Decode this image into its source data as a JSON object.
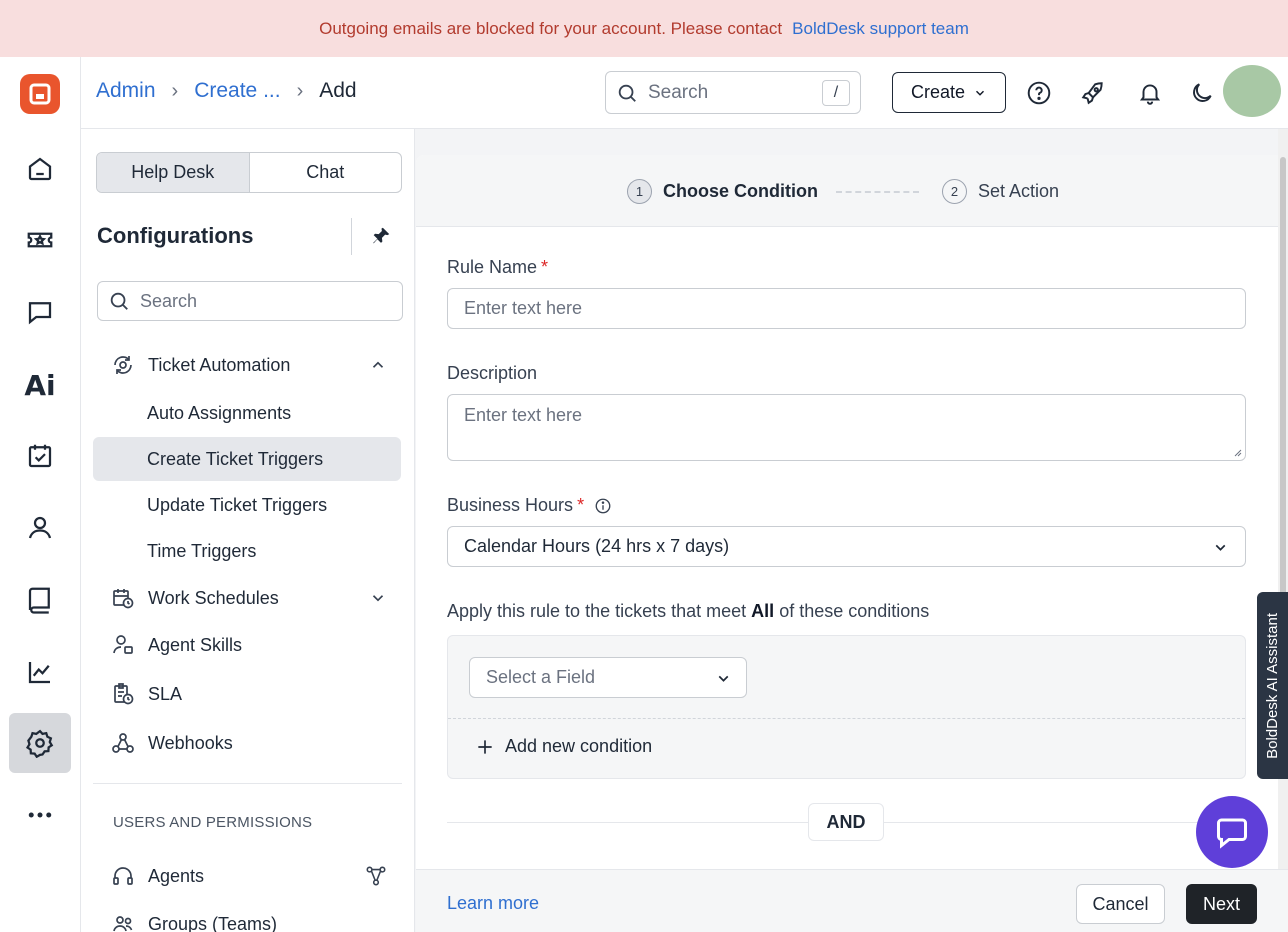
{
  "banner": {
    "message": "Outgoing emails are blocked for your account. Please contact",
    "link": "BoldDesk support team"
  },
  "rail": {
    "items": [
      "home-icon",
      "ticket-icon",
      "chat-icon",
      "ai-icon",
      "tasks-icon",
      "contacts-icon",
      "knowledge-base-icon",
      "reports-icon",
      "settings-icon",
      "more-icon"
    ],
    "ai_label": "Ai"
  },
  "header": {
    "breadcrumb": [
      "Admin",
      "Create ...",
      "Add"
    ],
    "search_placeholder": "Search",
    "search_shortcut": "/",
    "create_label": "Create"
  },
  "sidebar": {
    "tabs": [
      "Help Desk",
      "Chat"
    ],
    "title": "Configurations",
    "search_placeholder": "Search",
    "nav": [
      {
        "label": "Ticket Automation",
        "expanded": true
      },
      {
        "label": "Work Schedules",
        "expanded": false
      },
      {
        "label": "Agent Skills"
      },
      {
        "label": "SLA"
      },
      {
        "label": "Webhooks"
      }
    ],
    "sub_items": [
      "Auto Assignments",
      "Create Ticket Triggers",
      "Update Ticket Triggers",
      "Time Triggers"
    ],
    "selected": "Create Ticket Triggers",
    "section_heading": "USERS AND PERMISSIONS",
    "section_items": [
      "Agents",
      "Groups (Teams)"
    ]
  },
  "steps": [
    {
      "number": "1",
      "label": "Choose Condition"
    },
    {
      "number": "2",
      "label": "Set Action"
    }
  ],
  "form": {
    "rule_name_label": "Rule Name",
    "required_mark": "*",
    "rule_name_placeholder": "Enter text here",
    "description_label": "Description",
    "description_placeholder": "Enter text here",
    "business_hours_label": "Business Hours",
    "business_hours_value": "Calendar Hours (24 hrs x 7 days)",
    "apply_prefix": "Apply this rule to the tickets that meet",
    "apply_keyword": "All",
    "apply_suffix": "of these conditions",
    "field_placeholder": "Select a Field",
    "add_condition": "Add new condition",
    "and_label": "AND"
  },
  "footer": {
    "learn_more": "Learn more",
    "cancel": "Cancel",
    "next": "Next"
  },
  "assistant": {
    "tab_label": "BoldDesk AI Assistant"
  },
  "colors": {
    "accent": "#2f6fd0",
    "banner_bg": "#f8dede",
    "banner_text": "#b23b2e",
    "brand": "#e9552d",
    "chat_fab": "#5f3fd9"
  }
}
